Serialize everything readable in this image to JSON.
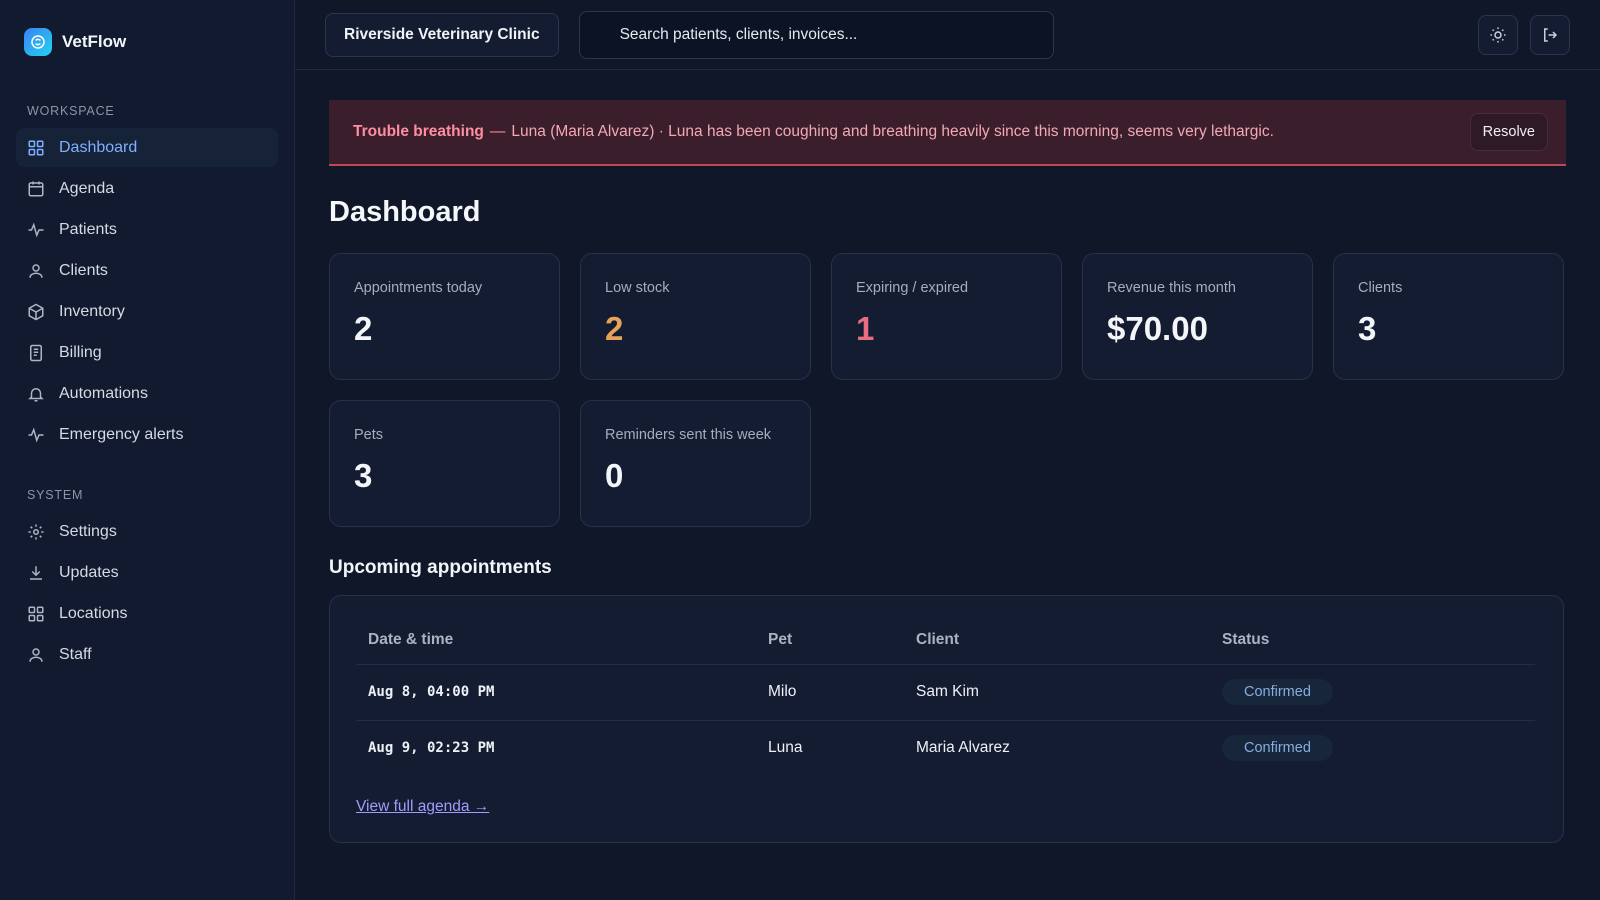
{
  "brand": {
    "name": "VetFlow"
  },
  "sidebar": {
    "workspace_label": "WORKSPACE",
    "workspace_items": [
      {
        "label": "Dashboard",
        "icon": "grid-icon"
      },
      {
        "label": "Agenda",
        "icon": "calendar-icon"
      },
      {
        "label": "Patients",
        "icon": "pulse-icon"
      },
      {
        "label": "Clients",
        "icon": "user-icon"
      },
      {
        "label": "Inventory",
        "icon": "box-icon"
      },
      {
        "label": "Billing",
        "icon": "receipt-icon"
      },
      {
        "label": "Automations",
        "icon": "bell-icon"
      },
      {
        "label": "Emergency alerts",
        "icon": "pulse-icon"
      }
    ],
    "system_label": "SYSTEM",
    "system_items": [
      {
        "label": "Settings",
        "icon": "gear-icon"
      },
      {
        "label": "Updates",
        "icon": "download-icon"
      },
      {
        "label": "Locations",
        "icon": "grid-icon"
      },
      {
        "label": "Staff",
        "icon": "user-icon"
      }
    ]
  },
  "topbar": {
    "clinic": "Riverside Veterinary Clinic",
    "search_placeholder": "Search patients, clients, invoices..."
  },
  "alert": {
    "title": "Trouble breathing",
    "separator": "—",
    "text": "Luna (Maria Alvarez) · Luna has been coughing and breathing heavily since this morning, seems very lethargic.",
    "resolve_label": "Resolve"
  },
  "page": {
    "title": "Dashboard"
  },
  "stats": [
    {
      "label": "Appointments today",
      "value": "2"
    },
    {
      "label": "Low stock",
      "value": "2"
    },
    {
      "label": "Expiring / expired",
      "value": "1"
    },
    {
      "label": "Revenue this month",
      "value": "$70.00"
    },
    {
      "label": "Clients",
      "value": "3"
    },
    {
      "label": "Pets",
      "value": "3"
    },
    {
      "label": "Reminders sent this week",
      "value": "0"
    }
  ],
  "colors": {
    "warn": "#e8a35a",
    "danger": "#e86d82",
    "accent": "#7fb0ff"
  },
  "appointments": {
    "title": "Upcoming appointments",
    "columns": [
      "Date & time",
      "Pet",
      "Client",
      "Status"
    ],
    "rows": [
      {
        "datetime": "Aug 8, 04:00 PM",
        "pet": "Milo",
        "client": "Sam Kim",
        "status": "Confirmed"
      },
      {
        "datetime": "Aug 9, 02:23 PM",
        "pet": "Luna",
        "client": "Maria Alvarez",
        "status": "Confirmed"
      }
    ],
    "link": "View full agenda →"
  }
}
